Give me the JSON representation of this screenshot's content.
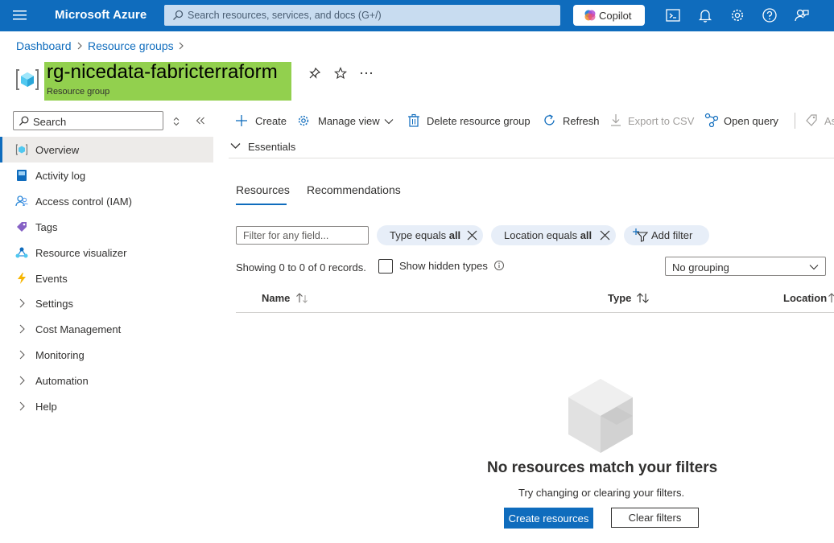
{
  "header": {
    "brand": "Microsoft Azure",
    "search_placeholder": "Search resources, services, and docs (G+/)",
    "copilot_label": "Copilot"
  },
  "breadcrumb": [
    "Dashboard",
    "Resource groups"
  ],
  "page": {
    "title": "rg-nicedata-fabricterraform",
    "subtitle": "Resource group"
  },
  "sidebar": {
    "search_placeholder": "Search",
    "items": [
      {
        "label": "Overview",
        "icon": "resource-group-icon",
        "active": true
      },
      {
        "label": "Activity log",
        "icon": "activity-log-icon"
      },
      {
        "label": "Access control (IAM)",
        "icon": "iam-icon"
      },
      {
        "label": "Tags",
        "icon": "tag-icon"
      },
      {
        "label": "Resource visualizer",
        "icon": "visualizer-icon"
      },
      {
        "label": "Events",
        "icon": "lightning-icon"
      },
      {
        "label": "Settings",
        "icon": "chevron-right-icon"
      },
      {
        "label": "Cost Management",
        "icon": "chevron-right-icon"
      },
      {
        "label": "Monitoring",
        "icon": "chevron-right-icon"
      },
      {
        "label": "Automation",
        "icon": "chevron-right-icon"
      },
      {
        "label": "Help",
        "icon": "chevron-right-icon"
      }
    ]
  },
  "toolbar": {
    "create": "Create",
    "manage_view": "Manage view",
    "delete": "Delete resource group",
    "refresh": "Refresh",
    "export": "Export to CSV",
    "open_query": "Open query",
    "overflow": "As"
  },
  "essentials": {
    "label": "Essentials"
  },
  "tabs": [
    "Resources",
    "Recommendations"
  ],
  "filters": {
    "placeholder": "Filter for any field...",
    "type_prefix": "Type equals ",
    "type_value": "all",
    "location_prefix": "Location equals ",
    "location_value": "all",
    "add_filter": "Add filter"
  },
  "records": {
    "showing": "Showing 0 to 0 of 0 records.",
    "show_hidden": "Show hidden types",
    "grouping": "No grouping"
  },
  "table": {
    "columns": [
      "Name",
      "Type",
      "Location"
    ]
  },
  "empty_state": {
    "title": "No resources match your filters",
    "subtitle": "Try changing or clearing your filters.",
    "create_button": "Create resources",
    "clear_button": "Clear filters"
  },
  "colors": {
    "brand_blue": "#0f6cbd",
    "title_highlight": "#92d04e"
  }
}
